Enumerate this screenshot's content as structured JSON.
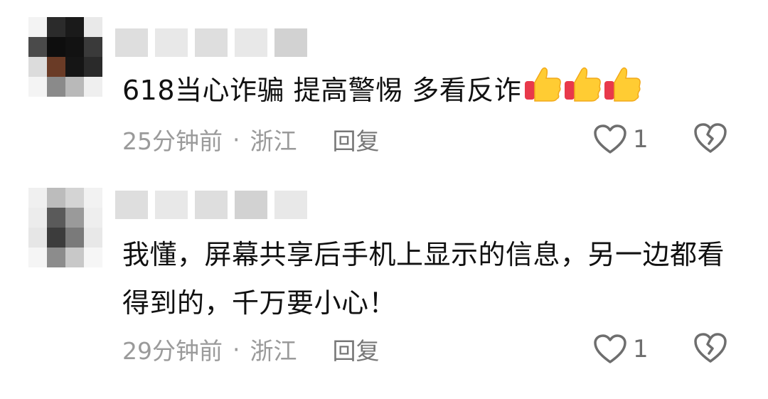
{
  "comments": [
    {
      "text": "618当心诈骗 提高警惕 多看反诈",
      "emoji": [
        "thumbs-up",
        "thumbs-up",
        "thumbs-up"
      ],
      "time": "25分钟前",
      "separator": "·",
      "location": "浙江",
      "reply_label": "回复",
      "likes": "1"
    },
    {
      "text": "我懂，屏幕共享后手机上显示的信息，另一边都看得到的，千万要小心！",
      "time": "29分钟前",
      "separator": "·",
      "location": "浙江",
      "reply_label": "回复",
      "likes": "1"
    }
  ],
  "icons": {
    "like": "heart-outline-icon",
    "dislike": "broken-heart-icon"
  },
  "colors": {
    "meta_text": "#9a9a9a",
    "icon_stroke": "#6e6e6e",
    "thumb_yellow": "#ffcc33",
    "thumb_red": "#e8394a"
  }
}
